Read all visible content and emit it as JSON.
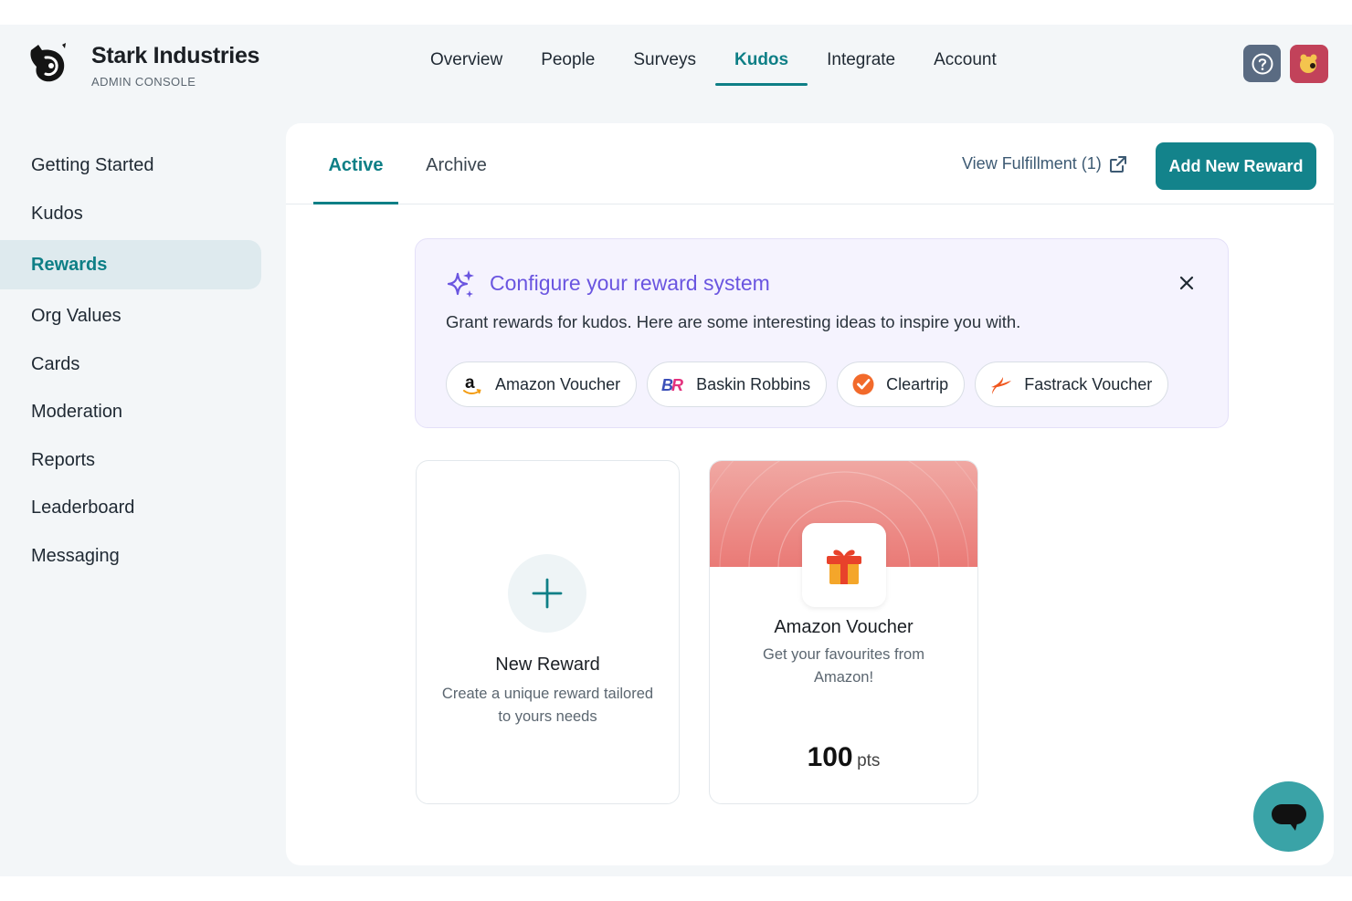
{
  "brand": {
    "name": "Stark Industries",
    "subtitle": "ADMIN CONSOLE"
  },
  "topnav": {
    "items": [
      {
        "label": "Overview"
      },
      {
        "label": "People"
      },
      {
        "label": "Surveys"
      },
      {
        "label": "Kudos",
        "active": true
      },
      {
        "label": "Integrate"
      },
      {
        "label": "Account"
      }
    ]
  },
  "sidebar": {
    "items": [
      {
        "label": "Getting Started"
      },
      {
        "label": "Kudos"
      },
      {
        "label": "Rewards",
        "active": true
      },
      {
        "label": "Org Values"
      },
      {
        "label": "Cards"
      },
      {
        "label": "Moderation"
      },
      {
        "label": "Reports"
      },
      {
        "label": "Leaderboard"
      },
      {
        "label": "Messaging"
      }
    ]
  },
  "tabs": {
    "active": "Active",
    "archive": "Archive"
  },
  "actions": {
    "view_fulfillment": "View Fulfillment (1)",
    "add_reward": "Add New Reward"
  },
  "banner": {
    "title": "Configure your reward system",
    "text": "Grant rewards for kudos. Here are some interesting ideas to inspire you with.",
    "chips": [
      {
        "label": "Amazon Voucher",
        "icon": "amazon-logo"
      },
      {
        "label": "Baskin Robbins",
        "icon": "baskin-robbins-logo"
      },
      {
        "label": "Cleartrip",
        "icon": "cleartrip-logo"
      },
      {
        "label": "Fastrack Voucher",
        "icon": "fastrack-logo"
      }
    ]
  },
  "cards": {
    "new_reward": {
      "title": "New Reward",
      "desc": "Create a unique reward tailored to yours needs"
    },
    "voucher": {
      "title": "Amazon Voucher",
      "desc": "Get your favourites from Amazon!",
      "points": "100",
      "points_unit": "pts"
    }
  },
  "colors": {
    "accent": "#0e7f86",
    "banner_title": "#6a55e0",
    "voucher_header": "#ea7a76",
    "chat": "#3aa3a7"
  }
}
